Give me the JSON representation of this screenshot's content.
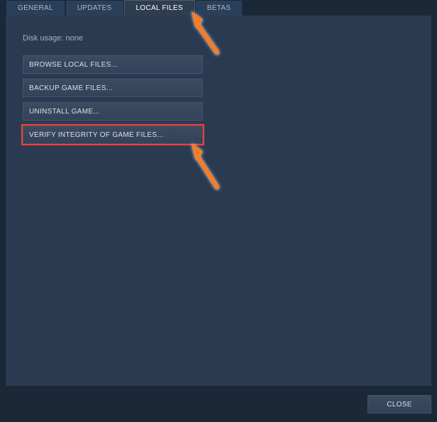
{
  "tabs": {
    "general": "GENERAL",
    "updates": "UPDATES",
    "local_files": "LOCAL FILES",
    "betas": "BETAS"
  },
  "content": {
    "disk_usage": "Disk usage: none",
    "buttons": {
      "browse": "BROWSE LOCAL FILES...",
      "backup": "BACKUP GAME FILES...",
      "uninstall": "UNINSTALL GAME...",
      "verify": "VERIFY INTEGRITY OF GAME FILES..."
    }
  },
  "footer": {
    "close": "CLOSE"
  },
  "annotation": {
    "arrow_color": "#ff7a1a"
  }
}
